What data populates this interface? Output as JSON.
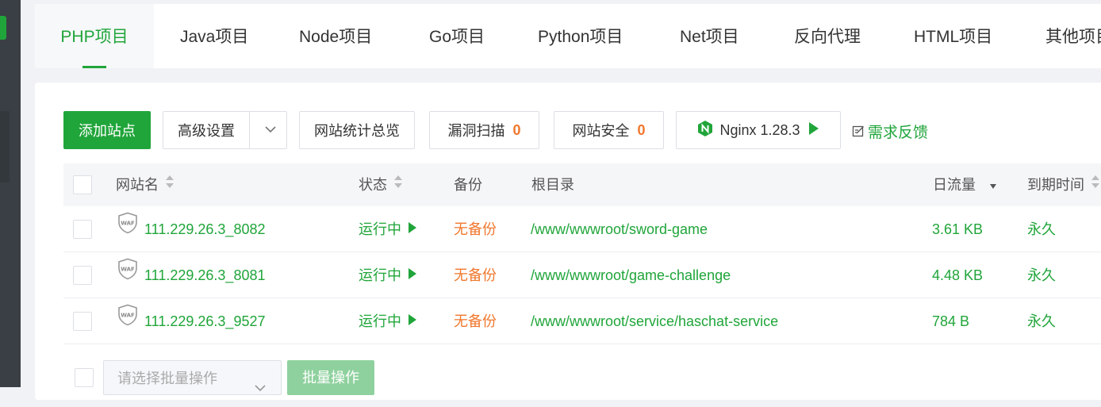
{
  "tabs": [
    {
      "label": "PHP项目",
      "active": true
    },
    {
      "label": "Java项目"
    },
    {
      "label": "Node项目"
    },
    {
      "label": "Go项目"
    },
    {
      "label": "Python项目"
    },
    {
      "label": "Net项目"
    },
    {
      "label": "反向代理"
    },
    {
      "label": "HTML项目"
    },
    {
      "label": "其他项目"
    }
  ],
  "toolbar": {
    "add_site": "添加站点",
    "advanced": "高级设置",
    "stats": "网站统计总览",
    "vuln_scan": "漏洞扫描",
    "vuln_count": "0",
    "security": "网站安全",
    "security_count": "0",
    "nginx": "Nginx 1.28.3",
    "feedback": "需求反馈"
  },
  "table": {
    "headers": {
      "name": "网站名",
      "status": "状态",
      "backup": "备份",
      "root": "根目录",
      "traffic": "日流量",
      "expire": "到期时间"
    },
    "rows": [
      {
        "name": "111.229.26.3_8082",
        "status": "运行中",
        "backup": "无备份",
        "root": "/www/wwwroot/sword-game",
        "traffic": "3.61 KB",
        "expire": "永久"
      },
      {
        "name": "111.229.26.3_8081",
        "status": "运行中",
        "backup": "无备份",
        "root": "/www/wwwroot/game-challenge",
        "traffic": "4.48 KB",
        "expire": "永久"
      },
      {
        "name": "111.229.26.3_9527",
        "status": "运行中",
        "backup": "无备份",
        "root": "/www/wwwroot/service/haschat-service",
        "traffic": "784 B",
        "expire": "永久"
      }
    ]
  },
  "bottom": {
    "batch_placeholder": "请选择批量操作",
    "batch_button": "批量操作"
  },
  "colors": {
    "accent": "#20a53a",
    "warning": "#f0772d",
    "sidebar": "#3a3f45"
  }
}
